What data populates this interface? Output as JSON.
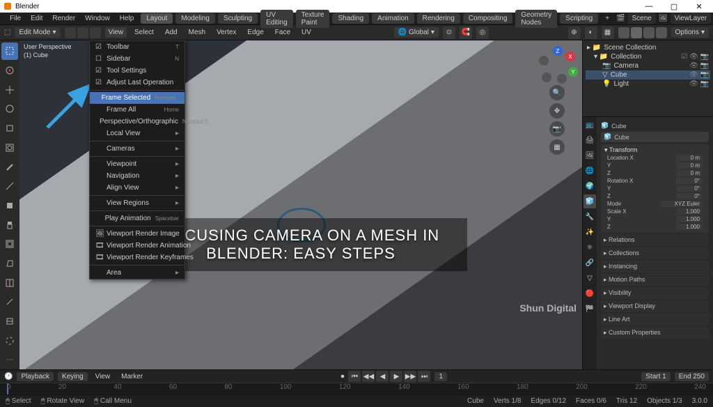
{
  "app": {
    "title": "Blender"
  },
  "winbuttons": [
    "—",
    "▢",
    "✕"
  ],
  "topmenu": {
    "logo_items": [
      "File",
      "Edit",
      "Render",
      "Window",
      "Help"
    ],
    "workspaces": [
      "Layout",
      "Modeling",
      "Sculpting",
      "UV Editing",
      "Texture Paint",
      "Shading",
      "Animation",
      "Rendering",
      "Compositing",
      "Geometry Nodes",
      "Scripting"
    ],
    "scene_label": "Scene",
    "viewlayer_label": "ViewLayer"
  },
  "toolbar2": {
    "mode": "Edit Mode",
    "menus": [
      "View",
      "Select",
      "Add",
      "Mesh",
      "Vertex",
      "Edge",
      "Face",
      "UV"
    ],
    "orientation": "Global",
    "options_label": "Options"
  },
  "overlay": {
    "l1": "User Perspective",
    "l2": "(1) Cube"
  },
  "viewmenu": {
    "items": [
      {
        "check": true,
        "label": "Toolbar",
        "sc": "T"
      },
      {
        "check": false,
        "label": "Sidebar",
        "sc": "N"
      },
      {
        "check": true,
        "label": "Tool Settings",
        "sc": ""
      },
      {
        "check": true,
        "label": "Adjust Last Operation",
        "sc": ""
      },
      {
        "sep": true
      },
      {
        "sel": true,
        "label": "Frame Selected",
        "sc": "Numpad ."
      },
      {
        "label": "Frame All",
        "sc": "Home"
      },
      {
        "label": "Perspective/Orthographic",
        "sc": "Numpad 5"
      },
      {
        "label": "Local View",
        "sub": true
      },
      {
        "sep": true
      },
      {
        "label": "Cameras",
        "sub": true
      },
      {
        "sep": true
      },
      {
        "label": "Viewpoint",
        "sub": true
      },
      {
        "label": "Navigation",
        "sub": true
      },
      {
        "label": "Align View",
        "sub": true
      },
      {
        "sep": true
      },
      {
        "label": "View Regions",
        "sub": true
      },
      {
        "sep": true
      },
      {
        "label": "Play Animation",
        "sc": "Spacebar"
      },
      {
        "sep": true
      },
      {
        "icon": "🖼",
        "label": "Viewport Render Image"
      },
      {
        "icon": "🎞",
        "label": "Viewport Render Animation"
      },
      {
        "icon": "🎞",
        "label": "Viewport Render Keyframes"
      },
      {
        "sep": true
      },
      {
        "label": "Area",
        "sub": true
      }
    ]
  },
  "caption": {
    "line1": "FOCUSING CAMERA ON A MESH IN",
    "line2": "BLENDER: EASY STEPS"
  },
  "watermark": "Shun Digital",
  "outliner": {
    "root": "Scene Collection",
    "coll": "Collection",
    "items": [
      "Camera",
      "Cube",
      "Light"
    ]
  },
  "props": {
    "object": "Cube",
    "transform_label": "Transform",
    "loc_label": "Location X",
    "loc_x": "0 m",
    "loc_y": "0 m",
    "loc_z": "0 m",
    "rot_label": "Rotation X",
    "rot_x": "0°",
    "rot_y": "0°",
    "rot_z": "0°",
    "rot_mode": "XYZ Euler",
    "scale_label": "Scale X",
    "sx": "1.000",
    "sy": "1.000",
    "sz": "1.000",
    "panels": [
      "Relations",
      "Collections",
      "Instancing",
      "Motion Paths",
      "Visibility",
      "Viewport Display",
      "Line Art",
      "Custom Properties"
    ]
  },
  "timeline": {
    "menus": [
      "Playback",
      "Keying",
      "View",
      "Marker"
    ],
    "frame": "1",
    "start": "Start 1",
    "end": "End 250",
    "ticks": [
      "0",
      "20",
      "40",
      "60",
      "80",
      "100",
      "120",
      "140",
      "160",
      "180",
      "200",
      "220",
      "240"
    ]
  },
  "status": {
    "left": [
      "Select",
      "Rotate View",
      "Call Menu"
    ],
    "right": [
      "Cube",
      "Verts 1/8",
      "Edges 0/12",
      "Faces 0/6",
      "Tris 12",
      "Objects 1/3",
      "3.0.0"
    ]
  }
}
